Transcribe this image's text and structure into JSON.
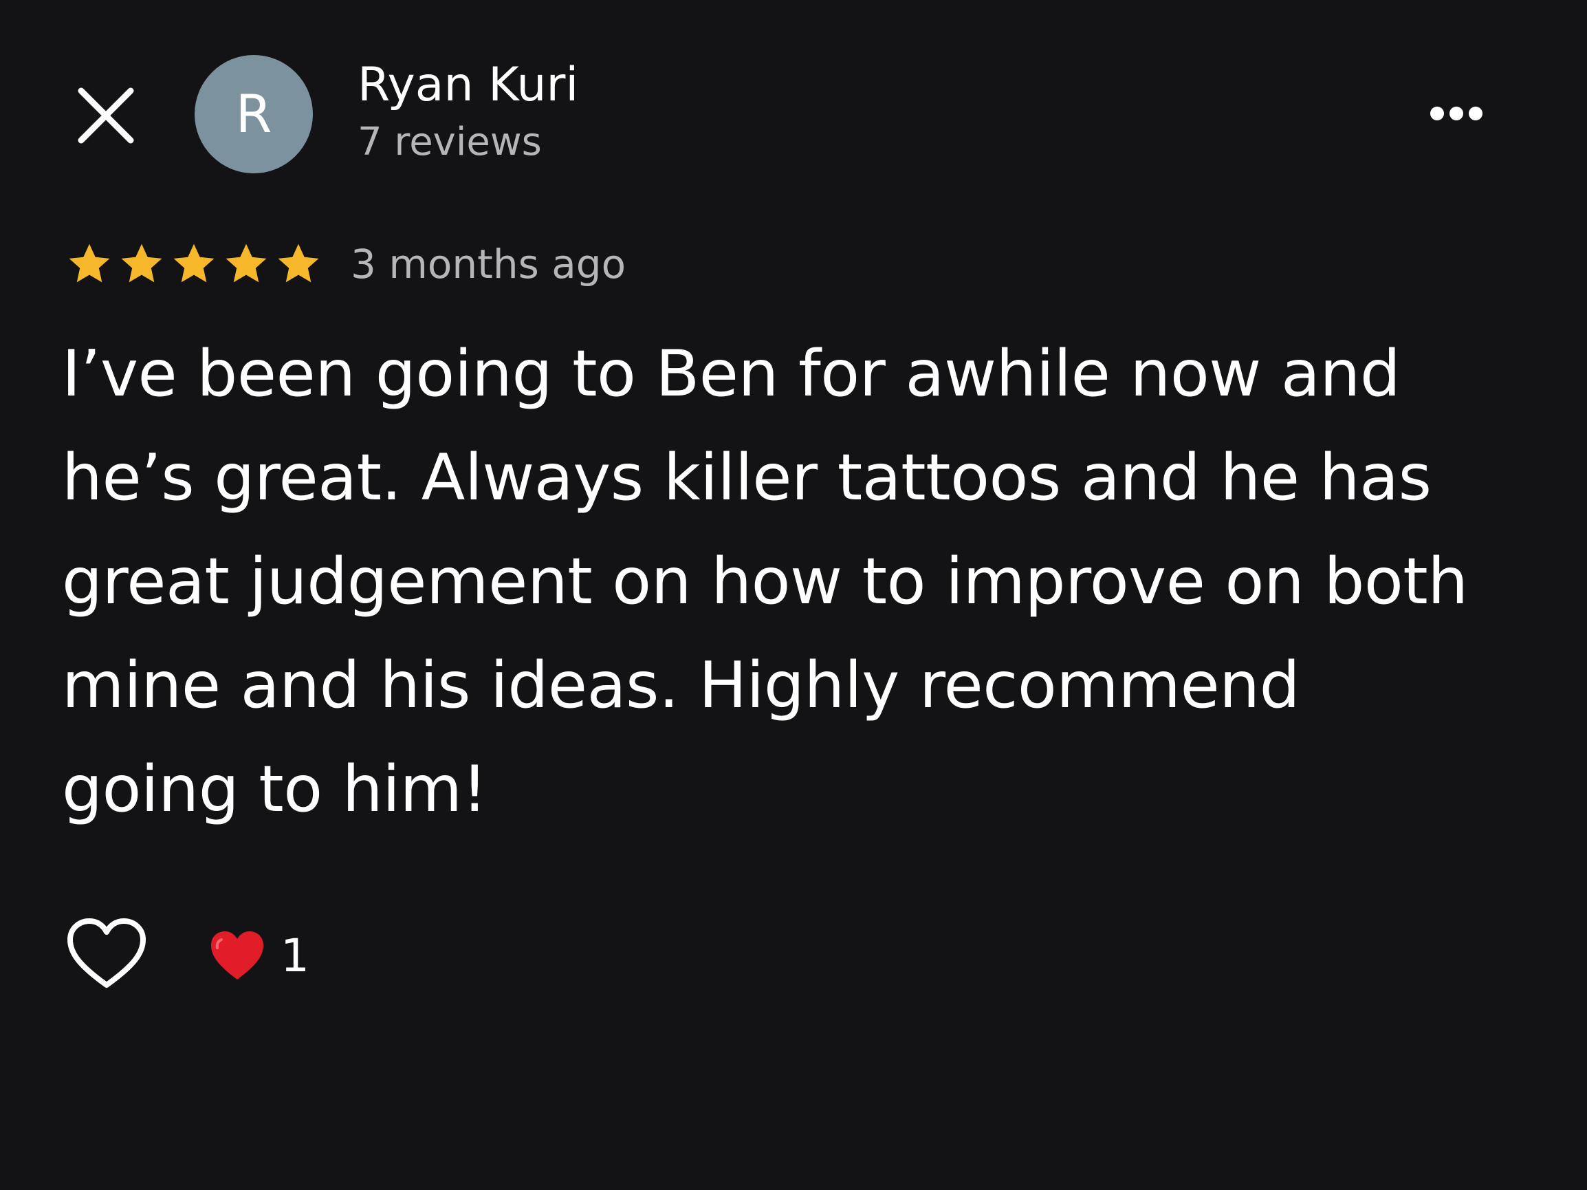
{
  "colors": {
    "background": "#131315",
    "star": "#f6b72a",
    "avatar_bg": "#7c939f",
    "secondary_text": "#b6b6ba",
    "reaction_heart": "#e11d2a"
  },
  "header": {
    "close_icon": "close-icon",
    "more_icon": "more-horizontal-icon",
    "avatar_letter": "R",
    "author_name": "Ryan Kuri",
    "review_count": "7 reviews"
  },
  "review": {
    "rating": 5,
    "rating_max": 5,
    "timestamp": "3 months ago",
    "text": "I’ve been going to Ben for awhile now and he’s great. Always killer tattoos and he has great judgement on how to improve on both mine and his ideas. Highly recommend going to him!"
  },
  "reactions": {
    "like_icon": "heart-outline-icon",
    "reaction_icon": "red-heart-icon",
    "count": "1"
  }
}
